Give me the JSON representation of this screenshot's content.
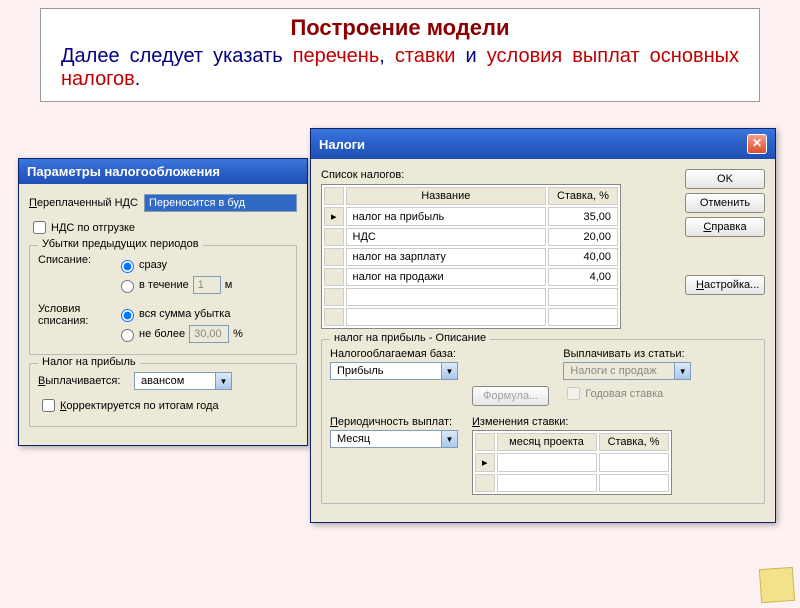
{
  "slide": {
    "title": "Построение модели",
    "text_pre": "Далее следует указать ",
    "red1": "перечень",
    "mid1": ", ",
    "red2": "ставки",
    "mid2": " и ",
    "red3": "условия выплат основных налогов",
    "tail": "."
  },
  "win1": {
    "title": "Параметры налогообложения",
    "overpaid_label": "Переплаченный НДС",
    "overpaid_value": "Переносится в буд",
    "vat_ship": "НДС по отгрузке",
    "losses_group": "Убытки предыдущих периодов",
    "writeoff_label": "Списание:",
    "writeoff_opt1": "сразу",
    "writeoff_opt2": "в течение",
    "writeoff_months": "1",
    "writeoff_unit": "м",
    "cond_label": "Условия списания:",
    "cond_opt1": "вся сумма убытка",
    "cond_opt2": "не более",
    "cond_value": "30,00",
    "cond_unit": "%",
    "profit_group": "Налог на прибыль",
    "paid_label": "Выплачивается:",
    "paid_value": "авансом",
    "corrected": "Корректируется по итогам года"
  },
  "win2": {
    "title": "Налоги",
    "list_label": "Список налогов:",
    "col_name": "Название",
    "col_rate": "Ставка, %",
    "rows": [
      {
        "name": "налог на прибыль",
        "rate": "35,00",
        "marker": "▸"
      },
      {
        "name": "НДС",
        "rate": "20,00",
        "marker": ""
      },
      {
        "name": "налог на зарплату",
        "rate": "40,00",
        "marker": ""
      },
      {
        "name": "налог на продажи",
        "rate": "4,00",
        "marker": ""
      }
    ],
    "ok": "OK",
    "cancel": "Отменить",
    "help": "Справка",
    "config": "Настройка...",
    "desc_group": "налог на прибыль - Описание",
    "base_label": "Налогооблагаемая база:",
    "base_value": "Прибыль",
    "formula": "Формула...",
    "pay_from_label": "Выплачивать из статьи:",
    "pay_from_value": "Налоги с продаж",
    "annual_rate": "Годовая ставка",
    "period_label": "Периодичность выплат:",
    "period_value": "Месяц",
    "changes_label": "Изменения ставки:",
    "ch_col_month": "месяц проекта",
    "ch_col_rate": "Ставка, %"
  }
}
